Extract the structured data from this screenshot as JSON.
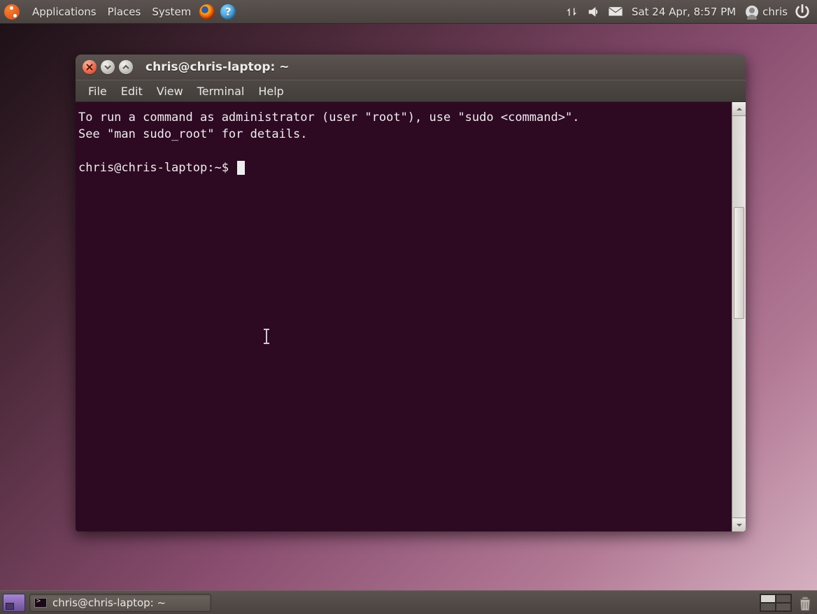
{
  "top_panel": {
    "menus": [
      "Applications",
      "Places",
      "System"
    ],
    "datetime": "Sat 24 Apr,  8:57 PM",
    "user": "chris"
  },
  "window": {
    "title": "chris@chris-laptop: ~",
    "menubar": [
      "File",
      "Edit",
      "View",
      "Terminal",
      "Help"
    ],
    "terminal": {
      "motd_line1": "To run a command as administrator (user \"root\"), use \"sudo <command>\".",
      "motd_line2": "See \"man sudo_root\" for details.",
      "prompt": "chris@chris-laptop:~$ "
    }
  },
  "bottom_panel": {
    "task_title": "chris@chris-laptop: ~"
  }
}
